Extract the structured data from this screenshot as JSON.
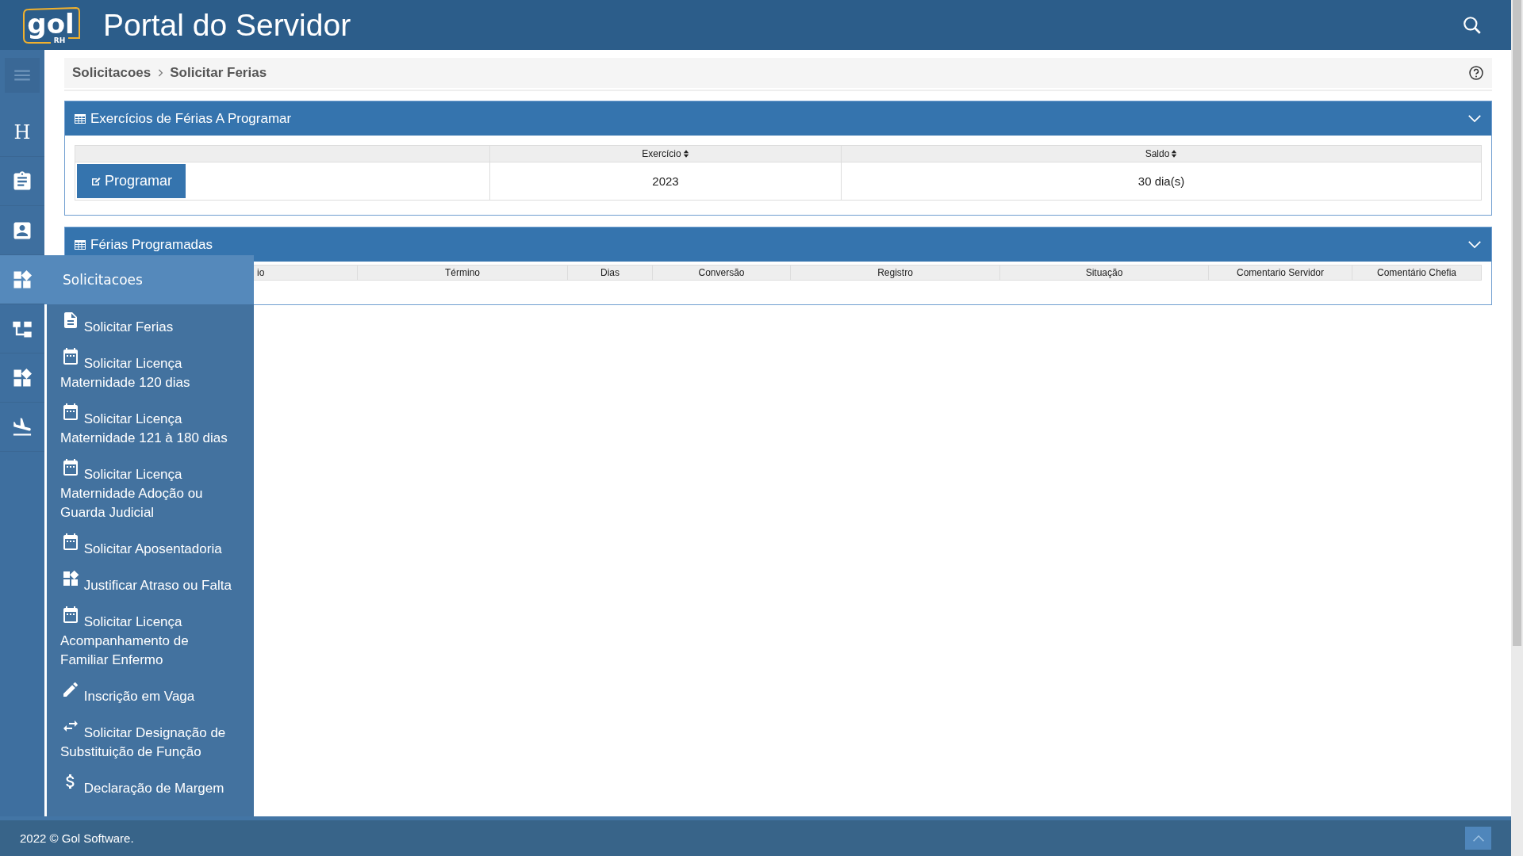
{
  "header": {
    "logo_text": "gol",
    "logo_sub": "RH",
    "title": "Portal do Servidor"
  },
  "sidebar": {
    "items": [
      {
        "kind": "menu",
        "selected": false
      },
      {
        "kind": "letter",
        "label": "H",
        "selected": false
      },
      {
        "kind": "clipboard",
        "selected": false
      },
      {
        "kind": "contact",
        "selected": false
      },
      {
        "kind": "widgets",
        "selected": true
      },
      {
        "kind": "sitemap",
        "selected": false
      },
      {
        "kind": "widgets",
        "selected": false
      },
      {
        "kind": "plane",
        "selected": false
      }
    ]
  },
  "breadcrumb": [
    "Solicitacoes",
    "Solicitar Ferias"
  ],
  "flyout": {
    "title": "Solicitacoes",
    "items": [
      {
        "kind": "document",
        "label": "Solicitar Ferias"
      },
      {
        "kind": "calendar",
        "label": "Solicitar Licença Maternidade 120 dias"
      },
      {
        "kind": "calendar",
        "label": "Solicitar Licença Maternidade 121 à 180 dias"
      },
      {
        "kind": "calendar",
        "label": "Solicitar Licença Maternidade Adoção ou Guarda Judicial"
      },
      {
        "kind": "calendar",
        "label": "Solicitar Aposentadoria"
      },
      {
        "kind": "widgets",
        "label": "Justificar Atraso ou Falta"
      },
      {
        "kind": "calendar",
        "label": "Solicitar Licença Acompanhamento de Familiar Enfermo"
      },
      {
        "kind": "pencil",
        "label": "Inscrição em Vaga"
      },
      {
        "kind": "swap",
        "label": "Solicitar Designação de Substituição de Função"
      },
      {
        "kind": "dollar",
        "label": "Declaração de Margem"
      }
    ]
  },
  "panels": [
    {
      "title": "Exercícios de Férias A Programar",
      "columns": [
        "Exercício",
        "Saldo"
      ],
      "rows": [
        {
          "action": "Programar",
          "cells": [
            "2023",
            "30 dia(s)"
          ]
        }
      ]
    },
    {
      "title": "Férias Programadas",
      "columns": [
        "io",
        "Término",
        "Dias",
        "Conversão",
        "Registro",
        "Situação",
        "Comentario Servidor",
        "Comentário Chefia"
      ]
    }
  ],
  "footer": {
    "text": "2022 © Gol Software."
  }
}
